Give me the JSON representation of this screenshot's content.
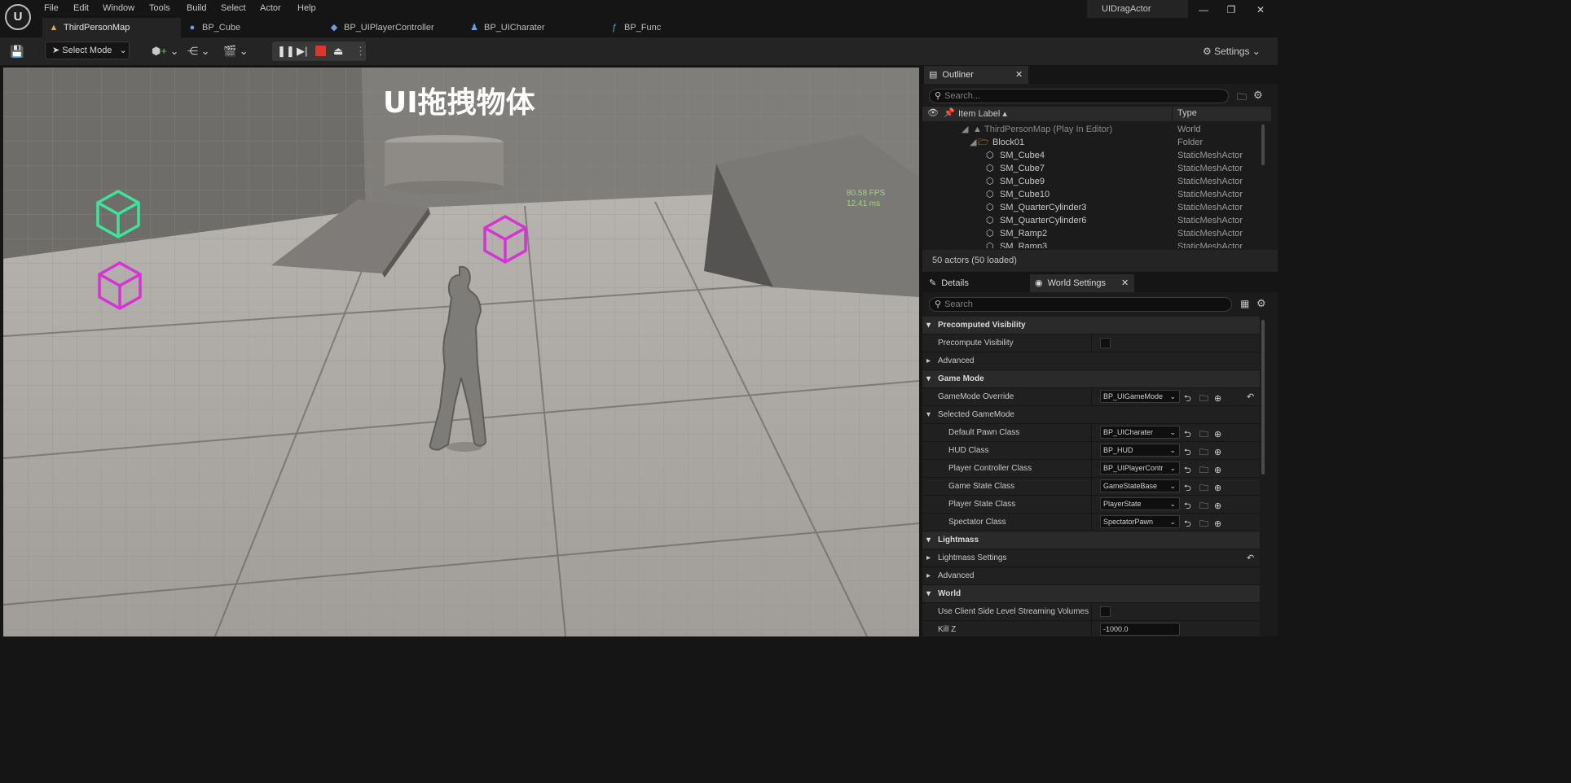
{
  "menu": [
    "File",
    "Edit",
    "Window",
    "Tools",
    "Build",
    "Select",
    "Actor",
    "Help"
  ],
  "project_name": "UIDragActor",
  "tabs": [
    "ThirdPersonMap",
    "BP_Cube",
    "BP_UIPlayerController",
    "BP_UICharater",
    "BP_Func"
  ],
  "toolbar": {
    "select_mode": "Select Mode",
    "settings": "Settings"
  },
  "viewport": {
    "overlay_title": "UI拖拽物体",
    "fps": "80.58 FPS",
    "ms": "12.41 ms"
  },
  "outliner": {
    "tab": "Outliner",
    "search_placeholder": "Search...",
    "col_label": "Item Label",
    "col_type": "Type",
    "rows": [
      {
        "label": "ThirdPersonMap (Play In Editor)",
        "type": "World"
      },
      {
        "label": "Block01",
        "type": "Folder"
      },
      {
        "label": "SM_Cube4",
        "type": "StaticMeshActor"
      },
      {
        "label": "SM_Cube7",
        "type": "StaticMeshActor"
      },
      {
        "label": "SM_Cube9",
        "type": "StaticMeshActor"
      },
      {
        "label": "SM_Cube10",
        "type": "StaticMeshActor"
      },
      {
        "label": "SM_QuarterCylinder3",
        "type": "StaticMeshActor"
      },
      {
        "label": "SM_QuarterCylinder6",
        "type": "StaticMeshActor"
      },
      {
        "label": "SM_Ramp2",
        "type": "StaticMeshActor"
      },
      {
        "label": "SM_Ramp3",
        "type": "StaticMeshActor"
      }
    ],
    "status": "50 actors (50 loaded)"
  },
  "details": {
    "tab_details": "Details",
    "tab_world": "World Settings",
    "search_placeholder": "Search",
    "precomputed_visibility": "Precomputed Visibility",
    "precompute_visibility": "Precompute Visibility",
    "advanced": "Advanced",
    "game_mode": "Game Mode",
    "gamemode_override": "GameMode Override",
    "gamemode_override_value": "BP_UIGameMode",
    "selected_gamemode": "Selected GameMode",
    "classes": [
      {
        "label": "Default Pawn Class",
        "value": "BP_UICharater"
      },
      {
        "label": "HUD Class",
        "value": "BP_HUD"
      },
      {
        "label": "Player Controller Class",
        "value": "BP_UIPlayerContr"
      },
      {
        "label": "Game State Class",
        "value": "GameStateBase"
      },
      {
        "label": "Player State Class",
        "value": "PlayerState"
      },
      {
        "label": "Spectator Class",
        "value": "SpectatorPawn"
      }
    ],
    "lightmass": "Lightmass",
    "lightmass_settings": "Lightmass Settings",
    "advanced2": "Advanced",
    "world": "World",
    "use_client_side": "Use Client Side Level Streaming Volumes",
    "kill_z": "Kill Z",
    "kill_z_value": "-1000.0"
  }
}
